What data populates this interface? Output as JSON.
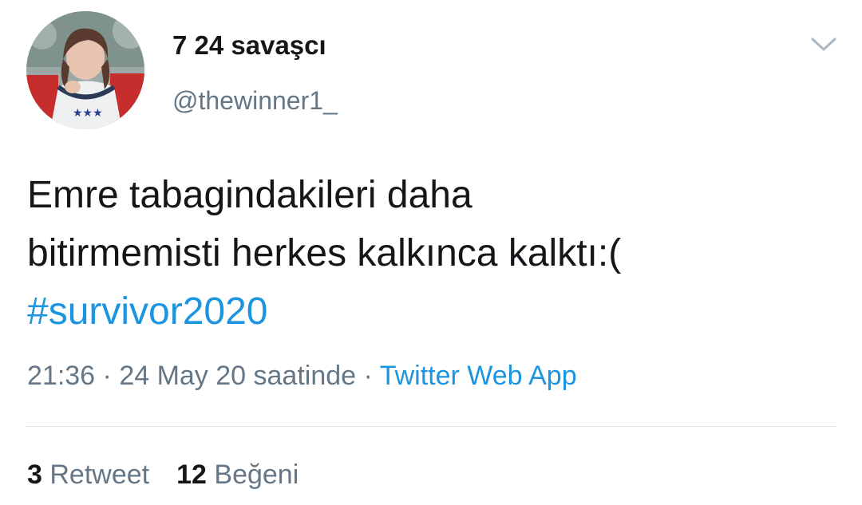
{
  "user": {
    "display_name": "7 24 savaşcı",
    "handle": "@thewinner1_"
  },
  "tweet": {
    "text_line1": "Emre tabagindakileri daha",
    "text_line2": "bitirmemisti herkes kalkınca kalktı:(",
    "hashtag": "#survivor2020"
  },
  "meta": {
    "time": "21:36",
    "separator": " · ",
    "date": "24 May 20 saatinde",
    "source": "Twitter Web App"
  },
  "stats": {
    "retweet_count": "3",
    "retweet_label": "Retweet",
    "like_count": "12",
    "like_label": "Beğeni"
  },
  "icons": {
    "menu": "chevron-down-icon"
  },
  "colors": {
    "link": "#1b95e0",
    "secondary_text": "#657786",
    "primary_text": "#14171a"
  }
}
